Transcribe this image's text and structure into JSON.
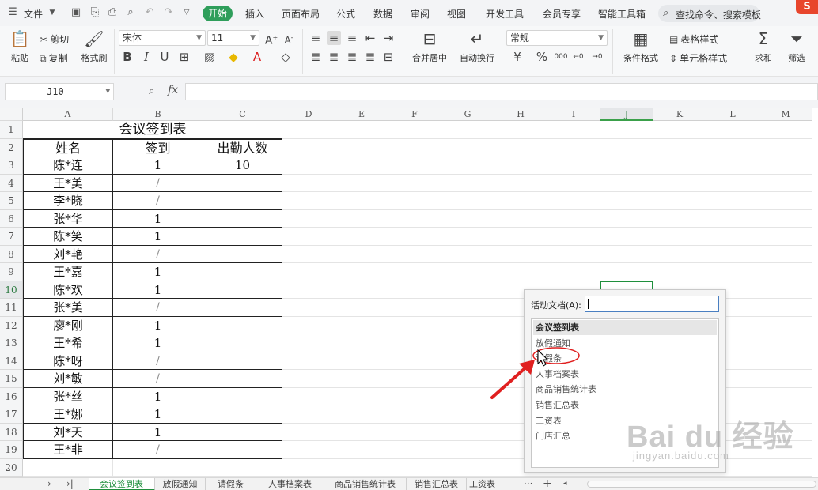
{
  "menubar": {
    "file_label": "文件",
    "tabs": [
      "开始",
      "插入",
      "页面布局",
      "公式",
      "数据",
      "审阅",
      "视图",
      "开发工具",
      "会员专享",
      "智能工具箱"
    ],
    "search_placeholder": "查找命令、搜索模板",
    "brand": "S"
  },
  "ribbon": {
    "paste": "粘贴",
    "cut": "剪切",
    "copy": "复制",
    "format_painter": "格式刷",
    "font_name": "宋体",
    "font_size": "11",
    "merge_center": "合并居中",
    "wrap_text": "自动换行",
    "number_format": "常规",
    "cond_format": "条件格式",
    "table_style": "表格样式",
    "cell_style": "单元格样式",
    "sum": "求和",
    "filter": "筛选",
    "grow_font": "A",
    "shrink_font": "A",
    "bold": "B",
    "italic": "I",
    "underline": "U",
    "font_color_glyph": "A",
    "currency": "¥",
    "percent": "%",
    "thousands": "000"
  },
  "formula_bar": {
    "name_box": "J10",
    "fx": "fx",
    "value": ""
  },
  "sheet": {
    "columns": [
      "A",
      "B",
      "C",
      "D",
      "E",
      "F",
      "G",
      "H",
      "I",
      "J",
      "K",
      "L",
      "M"
    ],
    "active_column": "J",
    "active_row": "10",
    "rows": [
      "1",
      "2",
      "3",
      "4",
      "5",
      "6",
      "7",
      "8",
      "9",
      "10",
      "11",
      "12",
      "13",
      "14",
      "15",
      "16",
      "17",
      "18",
      "19",
      "20"
    ],
    "title": "会议签到表",
    "headers": [
      "姓名",
      "签到",
      "出勤人数"
    ],
    "records": [
      {
        "name": "陈*连",
        "sign": "1",
        "count": "10"
      },
      {
        "name": "王*美",
        "sign": "/",
        "count": ""
      },
      {
        "name": "李*晓",
        "sign": "/",
        "count": ""
      },
      {
        "name": "张*华",
        "sign": "1",
        "count": ""
      },
      {
        "name": "陈*笑",
        "sign": "1",
        "count": ""
      },
      {
        "name": "刘*艳",
        "sign": "/",
        "count": ""
      },
      {
        "name": "王*嘉",
        "sign": "1",
        "count": ""
      },
      {
        "name": "陈*欢",
        "sign": "1",
        "count": ""
      },
      {
        "name": "张*美",
        "sign": "/",
        "count": ""
      },
      {
        "name": "廖*刚",
        "sign": "1",
        "count": ""
      },
      {
        "name": "王*希",
        "sign": "1",
        "count": ""
      },
      {
        "name": "陈*呀",
        "sign": "/",
        "count": ""
      },
      {
        "name": "刘*敏",
        "sign": "/",
        "count": ""
      },
      {
        "name": "张*丝",
        "sign": "1",
        "count": ""
      },
      {
        "name": "王*娜",
        "sign": "1",
        "count": ""
      },
      {
        "name": "刘*天",
        "sign": "1",
        "count": ""
      },
      {
        "name": "王*非",
        "sign": "/",
        "count": ""
      }
    ]
  },
  "dialog": {
    "label": "活动文档(A):",
    "input_value": "",
    "items": [
      "会议签到表",
      "放假通知",
      "请假条",
      "人事档案表",
      "商品销售统计表",
      "销售汇总表",
      "工资表",
      "门店汇总"
    ],
    "selected_index": 0
  },
  "sheet_tabs": {
    "tabs": [
      "会议签到表",
      "放假通知",
      "请假条",
      "人事档案表",
      "商品销售统计表",
      "销售汇总表",
      "工资表"
    ],
    "active_index": 0,
    "more": "···",
    "add": "+"
  },
  "watermark": {
    "main": "Bai du 经验",
    "sub": "jingyan.baidu.com"
  },
  "colors": {
    "accent_green": "#2f9e5b",
    "selection_green": "#1f8f3c",
    "annotation_red": "#e02020"
  }
}
